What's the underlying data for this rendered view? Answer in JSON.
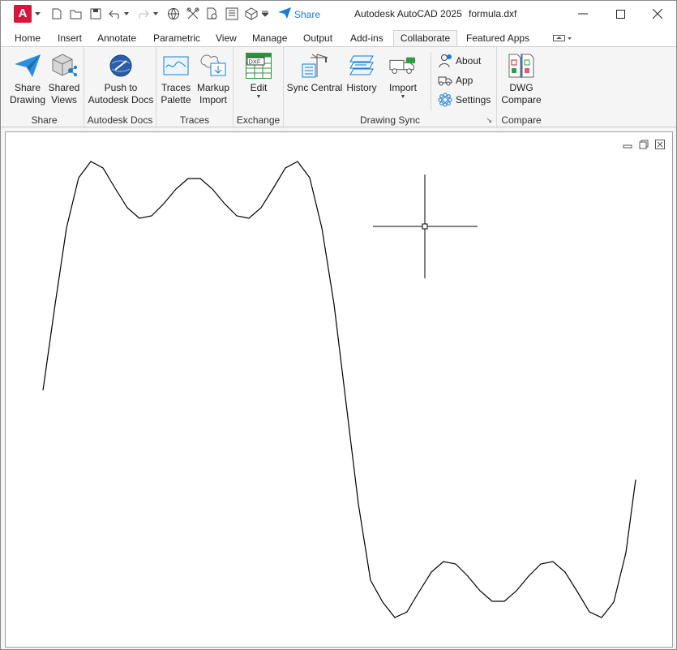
{
  "window": {
    "app_title": "Autodesk AutoCAD 2025",
    "file_name": "formula.dxf",
    "logo_letter": "A",
    "share_label": "Share"
  },
  "tabs": [
    {
      "label": "Home"
    },
    {
      "label": "Insert"
    },
    {
      "label": "Annotate"
    },
    {
      "label": "Parametric"
    },
    {
      "label": "View"
    },
    {
      "label": "Manage"
    },
    {
      "label": "Output"
    },
    {
      "label": "Add-ins"
    },
    {
      "label": "Collaborate",
      "active": true
    },
    {
      "label": "Featured Apps"
    }
  ],
  "ribbon": {
    "share": {
      "title": "Share",
      "share_drawing": [
        "Share",
        "Drawing"
      ],
      "shared_views": [
        "Shared",
        "Views"
      ]
    },
    "docs": {
      "title": "Autodesk Docs",
      "push": [
        "Push to",
        "Autodesk Docs"
      ]
    },
    "traces": {
      "title": "Traces",
      "palette": [
        "Traces",
        "Palette"
      ],
      "markup": [
        "Markup",
        "Import"
      ]
    },
    "exchange": {
      "title": "Exchange",
      "edit": "Edit",
      "dxf_badge": "DXF"
    },
    "sync": {
      "title": "Drawing Sync",
      "central": "Sync Central",
      "history": "History",
      "import": "Import",
      "about": "About",
      "app": "App",
      "settings": "Settings"
    },
    "compare": {
      "title": "Compare",
      "dwg": [
        "DWG",
        "Compare"
      ]
    }
  },
  "colors": {
    "brand": "#d6163b",
    "accent": "#1a7dcf"
  }
}
